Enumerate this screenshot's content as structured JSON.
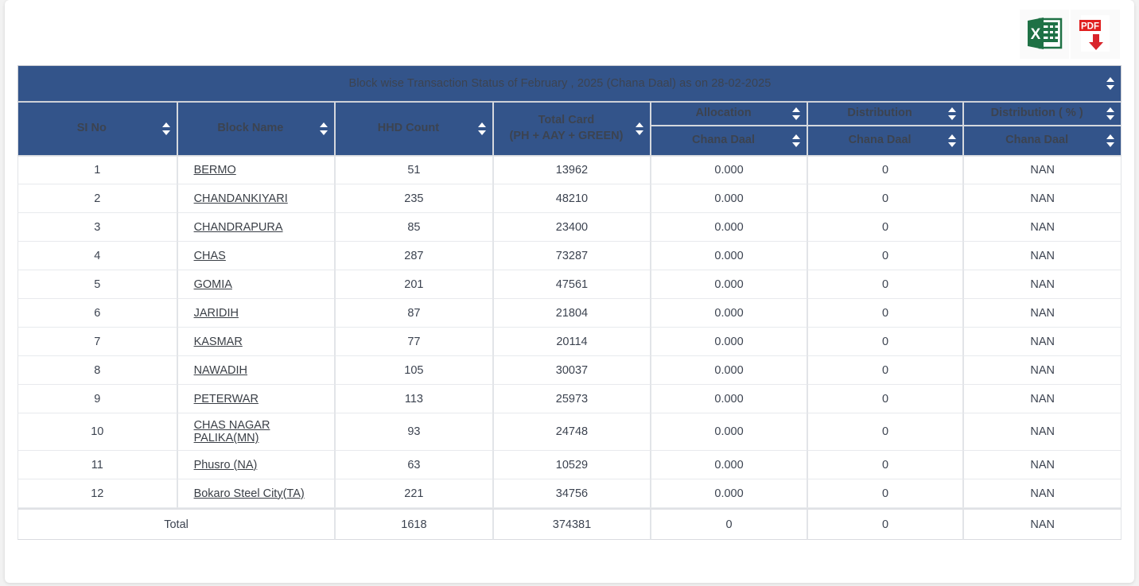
{
  "toolbar": {
    "excel_label": "X",
    "excel_name": "export-excel",
    "pdf_label": "PDF",
    "pdf_name": "export-pdf"
  },
  "table": {
    "title": "Block wise Transaction Status of February , 2025 (Chana Daal) as on 28-02-2025",
    "group_headers": [
      {
        "label": "SI No",
        "span": 1,
        "rowspan": 2
      },
      {
        "label": "Block Name",
        "span": 1,
        "rowspan": 2
      },
      {
        "label": "HHD Count",
        "span": 1,
        "rowspan": 2
      },
      {
        "label": "Total Card\n(PH + AAY + GREEN)",
        "span": 1,
        "rowspan": 2
      },
      {
        "label": "Allocation",
        "span": 1,
        "rowspan": 1
      },
      {
        "label": "Distribution",
        "span": 1,
        "rowspan": 1
      },
      {
        "label": "Distribution ( % )",
        "span": 1,
        "rowspan": 1
      }
    ],
    "headers": {
      "sl_no": "SI No",
      "block_name": "Block Name",
      "hhd_count": "HHD Count",
      "total_card_line1": "Total Card",
      "total_card_line2": "(PH + AAY + GREEN)",
      "allocation": "Allocation",
      "distribution": "Distribution",
      "distribution_pct": "Distribution ( % )",
      "sub_allocation": "Chana Daal",
      "sub_distribution": "Chana Daal",
      "sub_distribution_pct": "Chana Daal"
    },
    "rows": [
      {
        "sl": "1",
        "block": "BERMO",
        "hhd": "51",
        "total_card": "13962",
        "allocation": "0.000",
        "distribution": "0",
        "pct": "NAN"
      },
      {
        "sl": "2",
        "block": "CHANDANKIYARI",
        "hhd": "235",
        "total_card": "48210",
        "allocation": "0.000",
        "distribution": "0",
        "pct": "NAN"
      },
      {
        "sl": "3",
        "block": "CHANDRAPURA",
        "hhd": "85",
        "total_card": "23400",
        "allocation": "0.000",
        "distribution": "0",
        "pct": "NAN"
      },
      {
        "sl": "4",
        "block": "CHAS",
        "hhd": "287",
        "total_card": "73287",
        "allocation": "0.000",
        "distribution": "0",
        "pct": "NAN"
      },
      {
        "sl": "5",
        "block": "GOMIA",
        "hhd": "201",
        "total_card": "47561",
        "allocation": "0.000",
        "distribution": "0",
        "pct": "NAN"
      },
      {
        "sl": "6",
        "block": "JARIDIH",
        "hhd": "87",
        "total_card": "21804",
        "allocation": "0.000",
        "distribution": "0",
        "pct": "NAN"
      },
      {
        "sl": "7",
        "block": "KASMAR",
        "hhd": "77",
        "total_card": "20114",
        "allocation": "0.000",
        "distribution": "0",
        "pct": "NAN"
      },
      {
        "sl": "8",
        "block": "NAWADIH",
        "hhd": "105",
        "total_card": "30037",
        "allocation": "0.000",
        "distribution": "0",
        "pct": "NAN"
      },
      {
        "sl": "9",
        "block": "PETERWAR",
        "hhd": "113",
        "total_card": "25973",
        "allocation": "0.000",
        "distribution": "0",
        "pct": "NAN"
      },
      {
        "sl": "10",
        "block": "CHAS NAGAR PALIKA(MN)",
        "hhd": "93",
        "total_card": "24748",
        "allocation": "0.000",
        "distribution": "0",
        "pct": "NAN"
      },
      {
        "sl": "11",
        "block": "Phusro (NA)",
        "hhd": "63",
        "total_card": "10529",
        "allocation": "0.000",
        "distribution": "0",
        "pct": "NAN"
      },
      {
        "sl": "12",
        "block": "Bokaro Steel City(TA)",
        "hhd": "221",
        "total_card": "34756",
        "allocation": "0.000",
        "distribution": "0",
        "pct": "NAN"
      }
    ],
    "total_row": {
      "label": "Total",
      "hhd": "1618",
      "total_card": "374381",
      "allocation": "0",
      "distribution": "0",
      "pct": "NAN"
    }
  },
  "colors": {
    "header_blue": "#33548a",
    "page_bg": "#f2f2f2",
    "excel_green": "#1e7145",
    "pdf_red": "#d9242b"
  }
}
